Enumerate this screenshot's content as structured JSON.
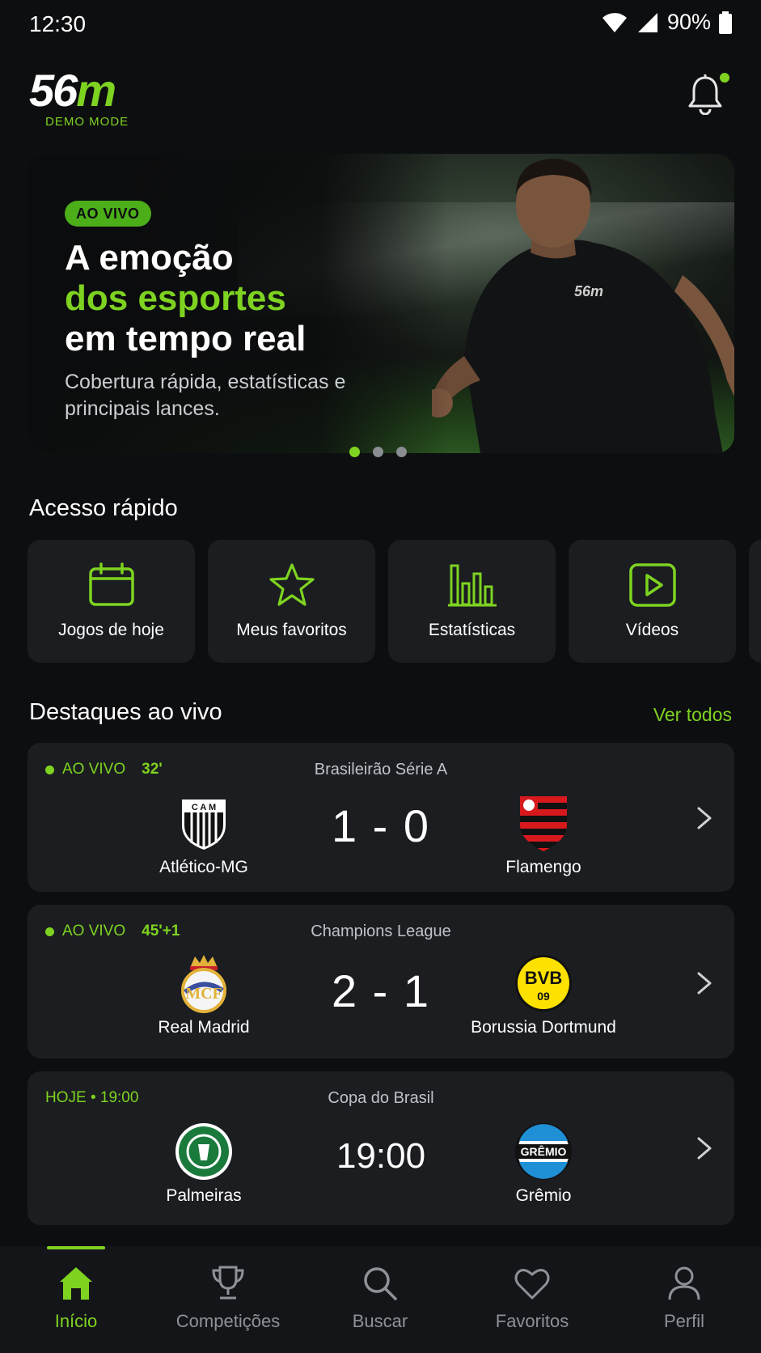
{
  "status_bar": {
    "time": "12:30",
    "battery": "90%"
  },
  "header": {
    "logo_number": "56",
    "logo_letter": "m",
    "logo_sub": "DEMO MODE"
  },
  "hero": {
    "badge": "AO VIVO",
    "title_line1": "A emoção",
    "title_line2": "dos esportes",
    "title_line3": "em tempo real",
    "subtitle": "Cobertura rápida, estatísticas e principais lances.",
    "jersey_logo": "56m",
    "pages": 3,
    "active_page": 1
  },
  "quick_access": {
    "title": "Acesso rápido",
    "items": [
      {
        "label": "Jogos de hoje",
        "icon": "calendar-icon"
      },
      {
        "label": "Meus favoritos",
        "icon": "star-icon"
      },
      {
        "label": "Estatísticas",
        "icon": "bar-chart-icon"
      },
      {
        "label": "Vídeos",
        "icon": "play-icon"
      }
    ]
  },
  "live": {
    "title": "Destaques ao vivo",
    "see_all": "Ver todos",
    "matches": [
      {
        "status": "AO VIVO",
        "minute": "32'",
        "league": "Brasileirão Série A",
        "home": "Atlético-MG",
        "away": "Flamengo",
        "score": "1 - 0"
      },
      {
        "status": "AO VIVO",
        "minute": "45'+1",
        "league": "Champions League",
        "home": "Real Madrid",
        "away": "Borussia Dortmund",
        "score": "2 - 1"
      },
      {
        "status": "HOJE • 19:00",
        "minute": "",
        "league": "Copa do Brasil",
        "home": "Palmeiras",
        "away": "Grêmio",
        "score": "19:00"
      }
    ]
  },
  "nav": {
    "items": [
      {
        "label": "Início",
        "icon": "home-icon",
        "active": true
      },
      {
        "label": "Competições",
        "icon": "trophy-icon"
      },
      {
        "label": "Buscar",
        "icon": "search-icon"
      },
      {
        "label": "Favoritos",
        "icon": "heart-icon"
      },
      {
        "label": "Perfil",
        "icon": "user-icon"
      }
    ]
  },
  "colors": {
    "accent": "#7ed321",
    "background": "#0d0e10",
    "card": "#1b1d20"
  }
}
